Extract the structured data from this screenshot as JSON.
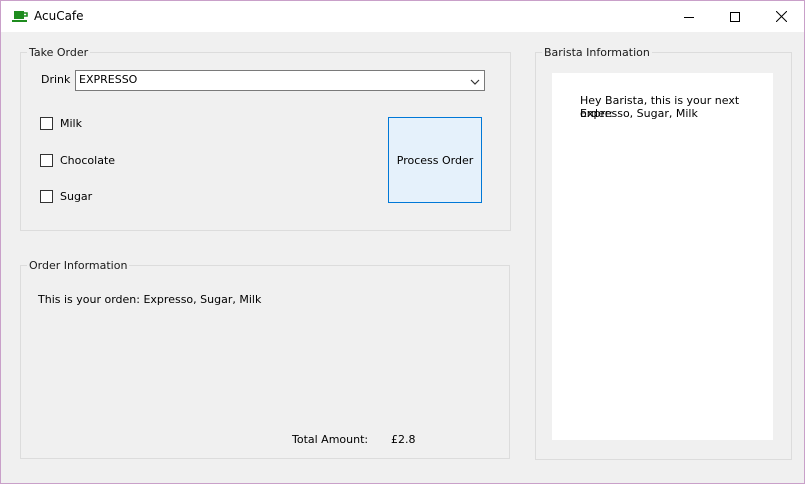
{
  "window": {
    "title": "AcuCafe",
    "icon": "coffee-cup-icon",
    "controls": [
      "minimize-icon",
      "maximize-icon",
      "close-icon"
    ]
  },
  "take_order": {
    "title": "Take Order",
    "drink_label": "Drink",
    "drink_value": "EXPRESSO",
    "options": [
      {
        "label": "Milk",
        "checked": false
      },
      {
        "label": "Chocolate",
        "checked": false
      },
      {
        "label": "Sugar",
        "checked": false
      }
    ],
    "process_button": "Process Order"
  },
  "order_info": {
    "title": "Order Information",
    "text": "This is your orden: Expresso, Sugar, Milk",
    "total_label": "Total Amount:",
    "total_value": "£2.8"
  },
  "barista_info": {
    "title": "Barista Information",
    "line1": "Hey Barista, this is your next order:",
    "line2": "Expresso, Sugar, Milk"
  },
  "colors": {
    "window_bg": "#f0f0f0",
    "button_bg": "#e5f1fb",
    "button_border": "#0078d7",
    "icon_green": "#1e8c1e"
  }
}
